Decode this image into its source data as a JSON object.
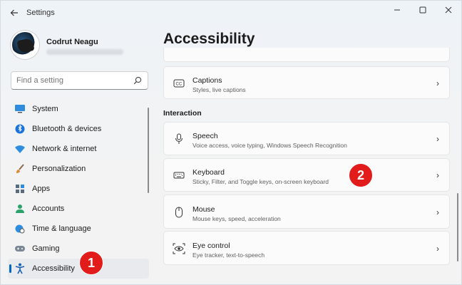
{
  "window": {
    "title": "Settings",
    "controls": {
      "minimize": "—",
      "maximize": "☐",
      "close": "✕"
    }
  },
  "profile": {
    "name": "Codrut Neagu"
  },
  "search": {
    "placeholder": "Find a setting"
  },
  "sidebar": {
    "items": [
      {
        "label": "System",
        "icon": "monitor-icon"
      },
      {
        "label": "Bluetooth & devices",
        "icon": "bluetooth-icon"
      },
      {
        "label": "Network & internet",
        "icon": "wifi-icon"
      },
      {
        "label": "Personalization",
        "icon": "brush-icon"
      },
      {
        "label": "Apps",
        "icon": "apps-icon"
      },
      {
        "label": "Accounts",
        "icon": "person-icon"
      },
      {
        "label": "Time & language",
        "icon": "globe-clock-icon"
      },
      {
        "label": "Gaming",
        "icon": "gamepad-icon"
      },
      {
        "label": "Accessibility",
        "icon": "accessibility-icon",
        "selected": true
      }
    ]
  },
  "badges": {
    "one": "1",
    "two": "2",
    "color": "#e21b1b"
  },
  "main": {
    "title": "Accessibility",
    "captions": {
      "title": "Captions",
      "description": "Styles, live captions"
    },
    "interaction_header": "Interaction",
    "cards": [
      {
        "title": "Speech",
        "description": "Voice access, voice typing, Windows Speech Recognition",
        "icon": "microphone-icon"
      },
      {
        "title": "Keyboard",
        "description": "Sticky, Filter, and Toggle keys, on-screen keyboard",
        "icon": "keyboard-icon"
      },
      {
        "title": "Mouse",
        "description": "Mouse keys, speed, acceleration",
        "icon": "mouse-icon"
      },
      {
        "title": "Eye control",
        "description": "Eye tracker, text-to-speech",
        "icon": "eye-icon"
      }
    ]
  },
  "colors": {
    "accent": "#0067c0",
    "background": "#f3f3f3",
    "card": "#fbfbfb"
  }
}
